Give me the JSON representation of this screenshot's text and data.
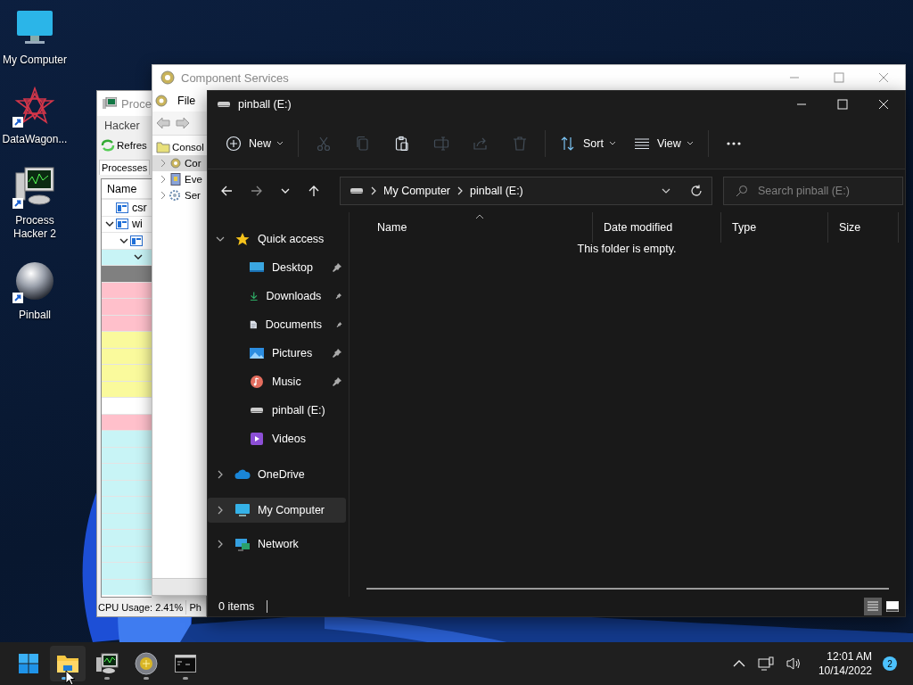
{
  "desktop_icons": [
    {
      "label": "My Computer",
      "kind": "computer",
      "shortcut": false
    },
    {
      "label": "DataWagon...",
      "kind": "star",
      "shortcut": true
    },
    {
      "label": "Process Hacker 2",
      "kind": "hacker",
      "shortcut": true
    },
    {
      "label": "Pinball",
      "kind": "ball",
      "shortcut": true
    }
  ],
  "process_hacker_window": {
    "title": "Proce",
    "menu": [
      "Hacker"
    ],
    "toolbar": [
      "Refres"
    ],
    "tabs": [
      {
        "label": "Processes",
        "selected": true
      }
    ],
    "columns": [
      "Name"
    ],
    "tree": [
      {
        "name": "csr",
        "color": "#ffffff"
      },
      {
        "name": "wi",
        "expanded": true,
        "color": "#ffffff",
        "children": [
          {
            "expanded": true,
            "color": "#ffffff",
            "children": [
              {
                "expanded": true,
                "color": "#c8f4f6",
                "children": [
                  {
                    "color": "#808080"
                  },
                  {
                    "color": "#ffc0cb"
                  },
                  {
                    "color": "#ffc0cb"
                  },
                  {
                    "color": "#ffc0cb"
                  },
                  {
                    "color": "#fafa9c"
                  },
                  {
                    "color": "#fafa9c"
                  },
                  {
                    "color": "#fafa9c"
                  },
                  {
                    "color": "#fafa9c"
                  },
                  {
                    "color": "#ffffff"
                  },
                  {
                    "color": "#ffc0cb"
                  },
                  {
                    "color": "#c8f4f6"
                  },
                  {
                    "color": "#c8f4f6"
                  },
                  {
                    "color": "#c8f4f6"
                  },
                  {
                    "color": "#c8f4f6"
                  },
                  {
                    "color": "#c8f4f6"
                  },
                  {
                    "color": "#c8f4f6"
                  },
                  {
                    "color": "#c8f4f6"
                  },
                  {
                    "color": "#c8f4f6"
                  },
                  {
                    "color": "#c8f4f6"
                  },
                  {
                    "color": "#c8f4f6"
                  }
                ]
              }
            ]
          }
        ]
      }
    ],
    "status": [
      "CPU Usage: 2.41%",
      "Ph"
    ]
  },
  "component_services_window": {
    "title": "Component Services",
    "menu": [
      "File"
    ],
    "tree": [
      {
        "label": "Consol",
        "kind": "folder",
        "selected": false,
        "children": [
          {
            "label": "Cor",
            "kind": "component",
            "expanded": false,
            "selected": true
          },
          {
            "label": "Eve",
            "kind": "log",
            "expanded": false,
            "selected": false
          },
          {
            "label": "Ser",
            "kind": "gear",
            "expanded": false,
            "selected": false
          }
        ]
      }
    ]
  },
  "explorer_window": {
    "title": "pinball (E:)",
    "toolbar": [
      {
        "kind": "new",
        "label": "New",
        "disabled": false
      },
      {
        "kind": "cut",
        "disabled": true
      },
      {
        "kind": "copy",
        "disabled": true
      },
      {
        "kind": "paste",
        "disabled": false
      },
      {
        "kind": "rename",
        "disabled": true
      },
      {
        "kind": "share",
        "disabled": true
      },
      {
        "kind": "delete",
        "disabled": true
      },
      {
        "kind": "sort",
        "label": "Sort",
        "disabled": false
      },
      {
        "kind": "view",
        "label": "View",
        "disabled": false
      },
      {
        "kind": "more",
        "disabled": false
      }
    ],
    "address": [
      "My Computer",
      "pinball (E:)"
    ],
    "search": {
      "placeholder": "Search pinball (E:)"
    },
    "nav": [
      {
        "label": "Quick access",
        "kind": "star",
        "expanded": true,
        "selected": false,
        "children": [
          {
            "label": "Desktop",
            "kind": "desktop",
            "pinned": true,
            "selected": false
          },
          {
            "label": "Downloads",
            "kind": "download",
            "pinned": true,
            "selected": false
          },
          {
            "label": "Documents",
            "kind": "document",
            "pinned": true,
            "selected": false
          },
          {
            "label": "Pictures",
            "kind": "pictures",
            "pinned": true,
            "selected": false
          },
          {
            "label": "Music",
            "kind": "music",
            "pinned": true,
            "selected": false
          },
          {
            "label": "pinball (E:)",
            "kind": "drive",
            "pinned": false,
            "selected": false
          },
          {
            "label": "Videos",
            "kind": "videos",
            "pinned": false,
            "selected": false
          }
        ]
      },
      {
        "label": "OneDrive",
        "kind": "cloud",
        "expanded": false,
        "selected": false
      },
      {
        "label": "My Computer",
        "kind": "computer",
        "expanded": false,
        "selected": true
      },
      {
        "label": "Network",
        "kind": "network",
        "expanded": false,
        "selected": false
      }
    ],
    "columns": [
      {
        "label": "Name",
        "sorted": true
      },
      {
        "label": "Date modified",
        "sorted": false
      },
      {
        "label": "Type",
        "sorted": false
      },
      {
        "label": "Size",
        "sorted": false
      }
    ],
    "empty_message": "This folder is empty.",
    "status": "0 items",
    "view_buttons": [
      {
        "kind": "details",
        "selected": true
      },
      {
        "kind": "tiles",
        "selected": false
      }
    ]
  },
  "taskbar": {
    "apps": [
      {
        "kind": "start",
        "selected": false,
        "running": false
      },
      {
        "kind": "explorer",
        "selected": true,
        "running": true
      },
      {
        "kind": "hacker",
        "selected": false,
        "running": true
      },
      {
        "kind": "pinball",
        "selected": false,
        "running": true
      },
      {
        "kind": "terminal",
        "selected": false,
        "running": true
      }
    ],
    "time": "12:01 AM",
    "date": "10/14/2022",
    "notifications": "2"
  }
}
